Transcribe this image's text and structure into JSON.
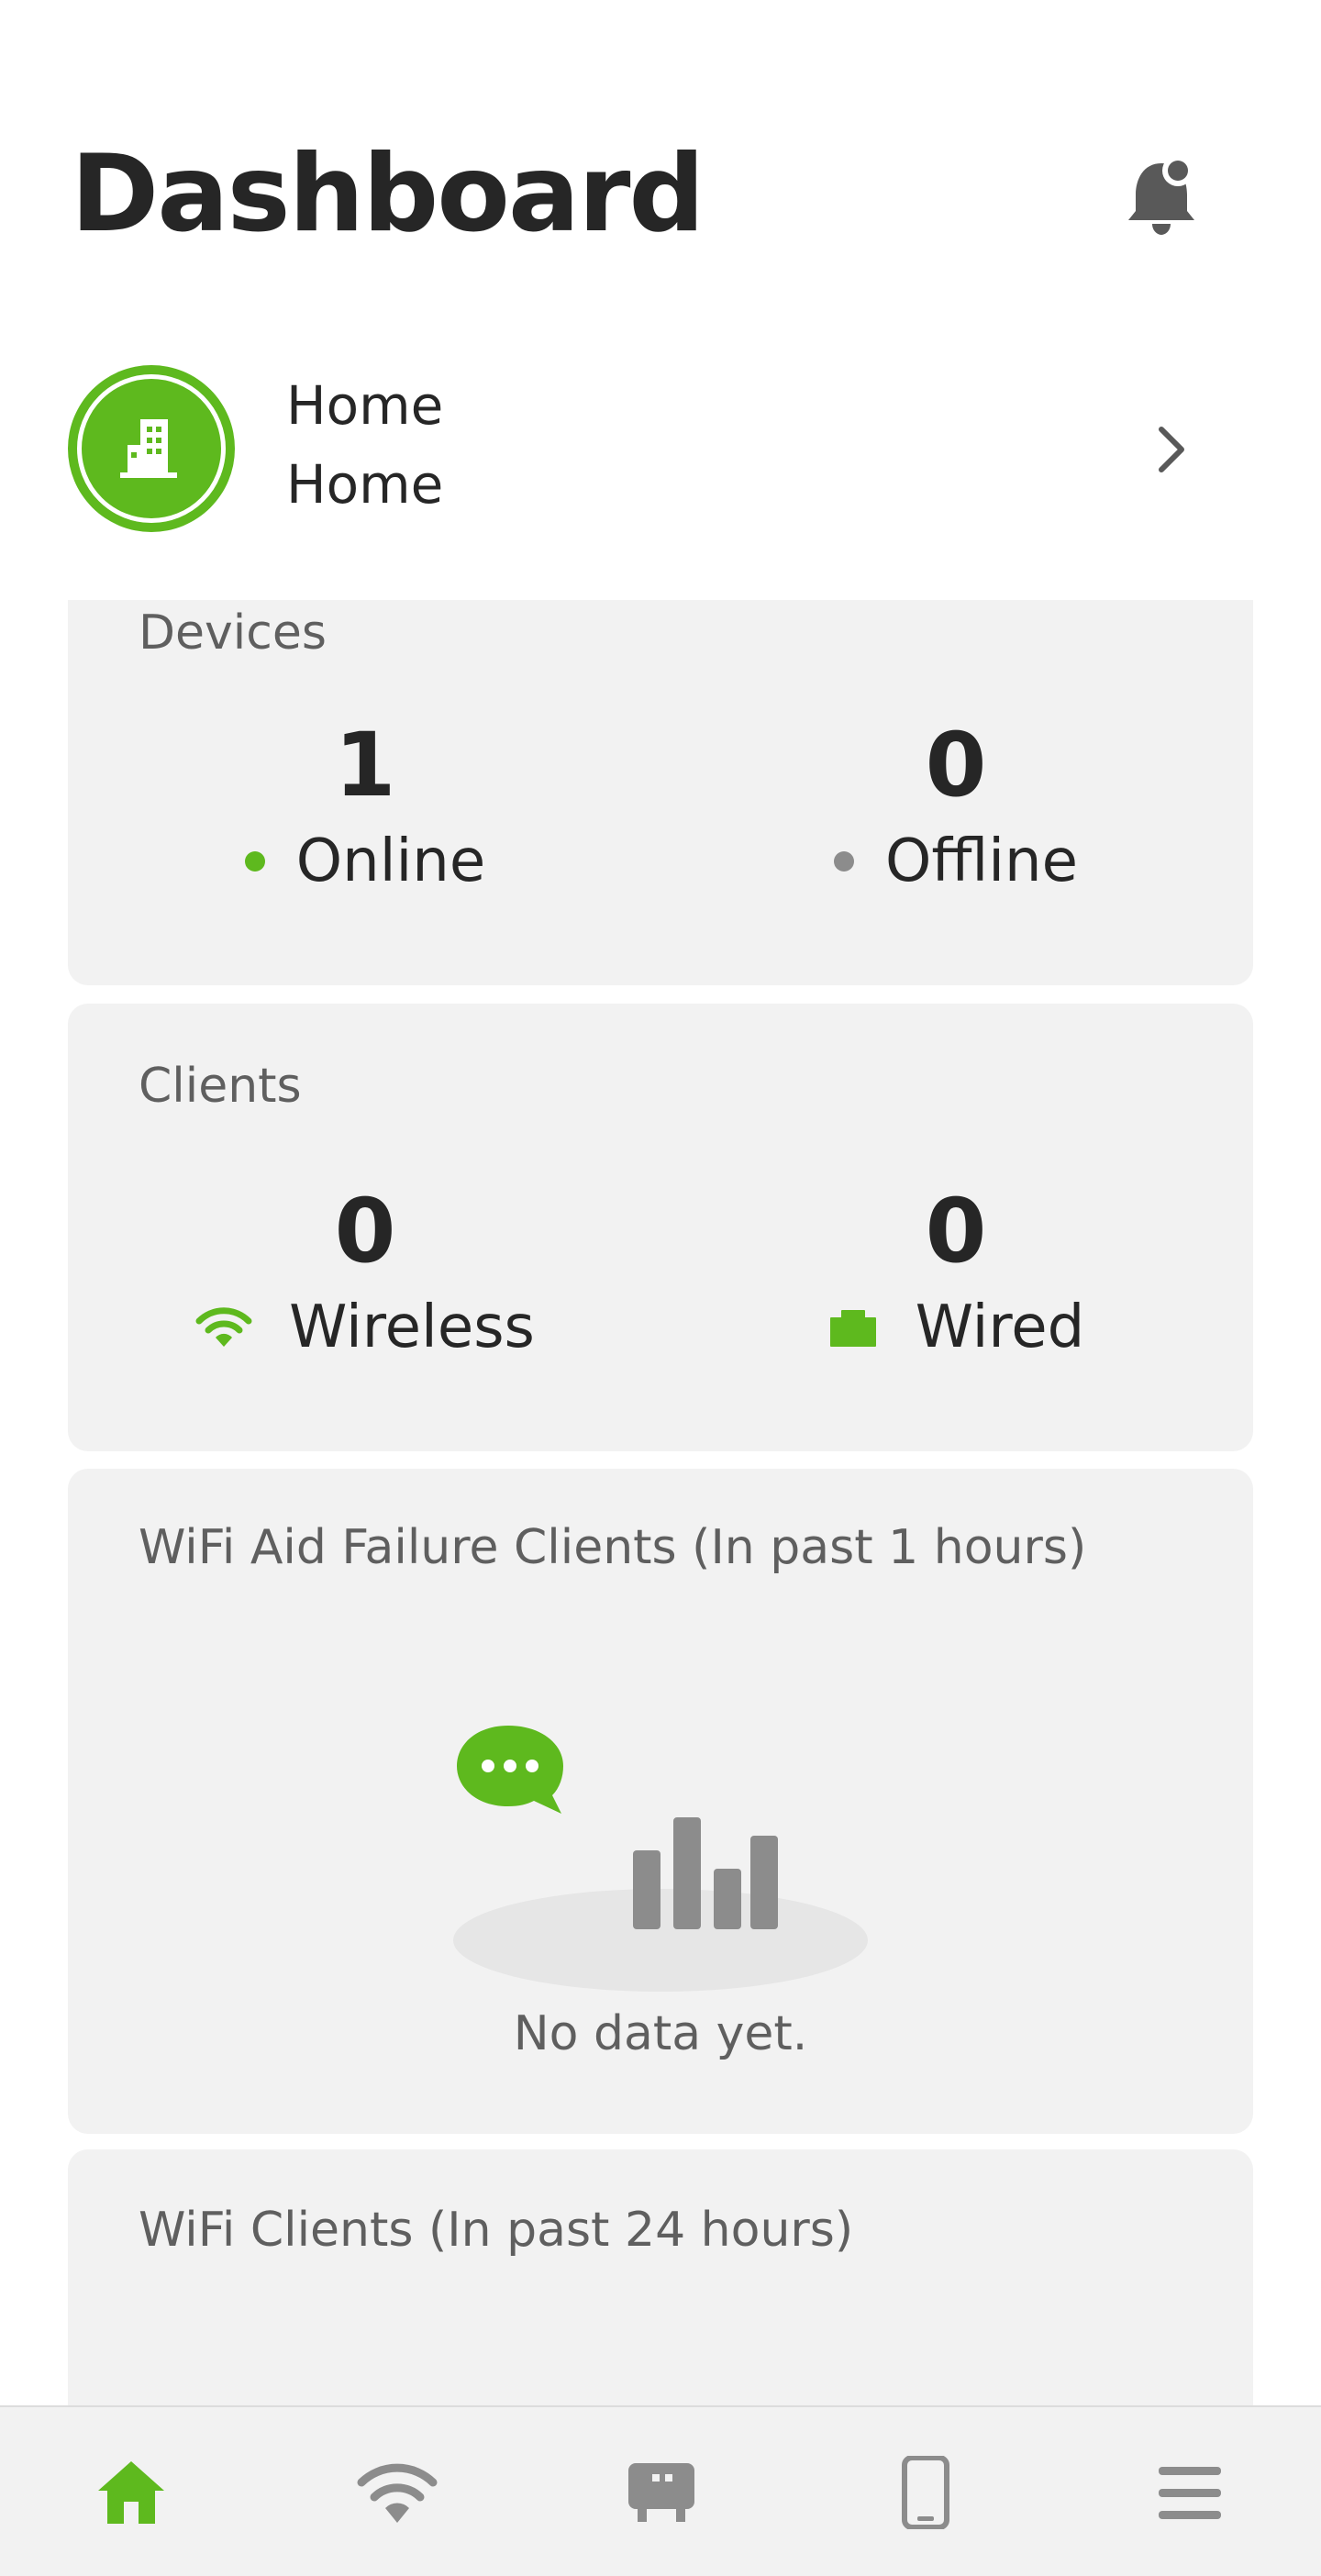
{
  "header": {
    "title": "Dashboard",
    "notification_icon": "bell-icon"
  },
  "site": {
    "name": "Home",
    "subtitle": "Home",
    "icon": "building-icon",
    "accent_color": "#5eb91e"
  },
  "devices_card": {
    "title": "Devices",
    "online": {
      "count": "1",
      "label": "Online",
      "color": "#5eb91e"
    },
    "offline": {
      "count": "0",
      "label": "Offline",
      "color": "#8c8c8c"
    }
  },
  "clients_card": {
    "title": "Clients",
    "wireless": {
      "count": "0",
      "label": "Wireless",
      "icon": "wifi-icon"
    },
    "wired": {
      "count": "0",
      "label": "Wired",
      "icon": "ethernet-icon"
    }
  },
  "wifi_aid_card": {
    "title": "WiFi Aid Failure Clients (In past 1 hours)",
    "empty_text": "No data yet."
  },
  "wifi_clients_card": {
    "title": "WiFi Clients (In past 24 hours)"
  },
  "tabbar": {
    "items": [
      {
        "name": "home",
        "icon": "home-icon",
        "active": true
      },
      {
        "name": "wifi",
        "icon": "wifi-icon",
        "active": false
      },
      {
        "name": "devices",
        "icon": "access-point-icon",
        "active": false
      },
      {
        "name": "clients",
        "icon": "phone-icon",
        "active": false
      },
      {
        "name": "menu",
        "icon": "menu-icon",
        "active": false
      }
    ],
    "active_color": "#5eb91e",
    "inactive_color": "#8c8c8c"
  }
}
